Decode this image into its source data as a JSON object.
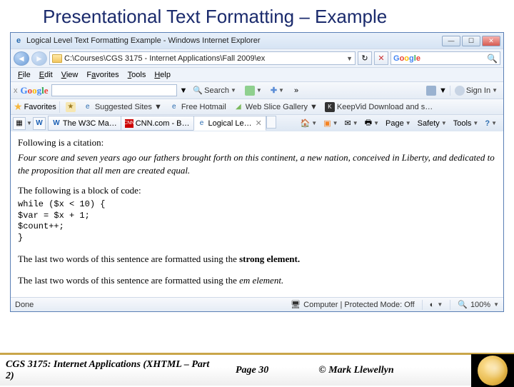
{
  "slide": {
    "title": "Presentational Text Formatting – Example"
  },
  "window": {
    "title": "Logical Level Text Formatting Example - Windows Internet Explorer"
  },
  "nav": {
    "address": "C:\\Courses\\CGS 3175 - Internet Applications\\Fall 2009\\ex",
    "searchPlaceholder": "Google"
  },
  "menus": {
    "file": "File",
    "edit": "Edit",
    "view": "View",
    "favorites": "Favorites",
    "tools": "Tools",
    "help": "Help"
  },
  "gtb": {
    "search_label": "Search",
    "more": "»",
    "signin": "Sign In"
  },
  "favbar": {
    "favorites": "Favorites",
    "suggested": "Suggested Sites",
    "hotmail": "Free Hotmail",
    "webslice": "Web Slice Gallery",
    "keepvid": "KeepVid  Download and s…"
  },
  "tabs": {
    "t1": "The W3C Ma…",
    "t2": "CNN.com - B…",
    "t3": "Logical Le…"
  },
  "tabtools": {
    "page": "Page",
    "safety": "Safety",
    "tools": "Tools"
  },
  "content": {
    "p1": "Following is a citation:",
    "cite": "Four score and seven years ago our fathers brought forth on this continent, a new nation, conceived in Liberty, and dedicated to the proposition that all men are created equal.",
    "p2": "The following is a block of code:",
    "code": "while ($x < 10) {\n$var = $x + 1;\n$count++;\n}",
    "p3a": "The last two words of this sentence are formatted using the ",
    "p3b": "strong element.",
    "p4a": "The last two words of this sentence are formatted using the ",
    "p4b": "em element."
  },
  "status": {
    "done": "Done",
    "zone": "Computer | Protected Mode: Off",
    "zoom": "100%"
  },
  "footer": {
    "course": "CGS 3175: Internet Applications (XHTML – Part 2)",
    "page": "Page 30",
    "author": "© Mark Llewellyn"
  }
}
